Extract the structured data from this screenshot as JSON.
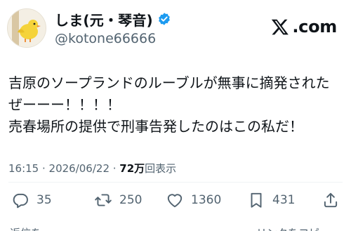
{
  "author": {
    "display_name": "しま(元・琴音)",
    "handle": "@kotone66666",
    "verified": true,
    "avatar_icon": "bird-plush-avatar"
  },
  "brand": {
    "text": ".com",
    "icon": "x-logo-icon"
  },
  "tweet": {
    "lines": [
      "吉原のソープランドのルーブルが無事に摘発されたぜーーー！！！！",
      "売春場所の提供で刑事告発したのはこの私だ！"
    ],
    "line1a": "吉原のソープランドのルーブルが無事に摘発された",
    "line1b": "ぜーーー！！！！",
    "line2": "売春場所の提供で刑事告発したのはこの私だ！"
  },
  "meta": {
    "timestamp": "16:15 · 2026/06/22 · ",
    "views_count": "72万",
    "views_label": "回表示"
  },
  "actions": {
    "reply_count": "35",
    "repost_count": "250",
    "like_count": "1360",
    "bookmark_count": "431"
  },
  "footer": {
    "left_label": "返信を",
    "right_label": "リンクをコピー"
  },
  "colors": {
    "verified": "#1d9bf0",
    "text": "#0f1419",
    "muted": "#536471"
  }
}
